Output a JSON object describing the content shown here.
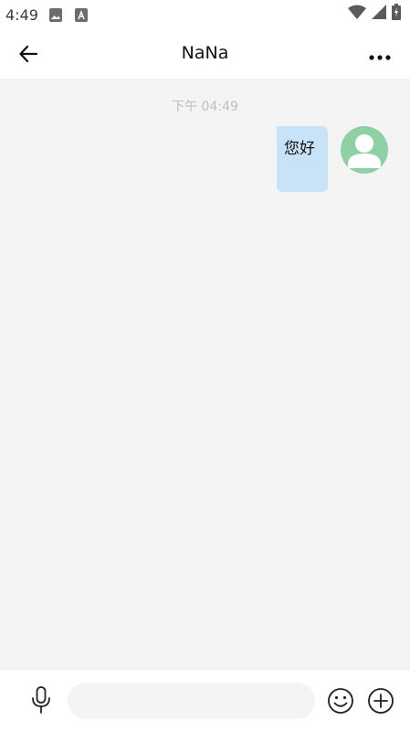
{
  "status_bar": {
    "time": "4:49",
    "icons": [
      "image-notification-icon",
      "text-notification-icon",
      "wifi-icon",
      "signal-icon",
      "battery-charging-icon"
    ]
  },
  "header": {
    "title": "NaNa",
    "back_icon": "arrow-left-icon",
    "more_icon": "more-horizontal-icon"
  },
  "chat": {
    "timestamp": "下午 04:49",
    "messages": [
      {
        "direction": "outgoing",
        "text": "您好"
      }
    ]
  },
  "input_bar": {
    "placeholder": "",
    "value": ""
  },
  "colors": {
    "bubble_outgoing": "#c8e2f8",
    "avatar_bg": "#8fd0a4",
    "chat_bg": "#f4f4f5"
  }
}
